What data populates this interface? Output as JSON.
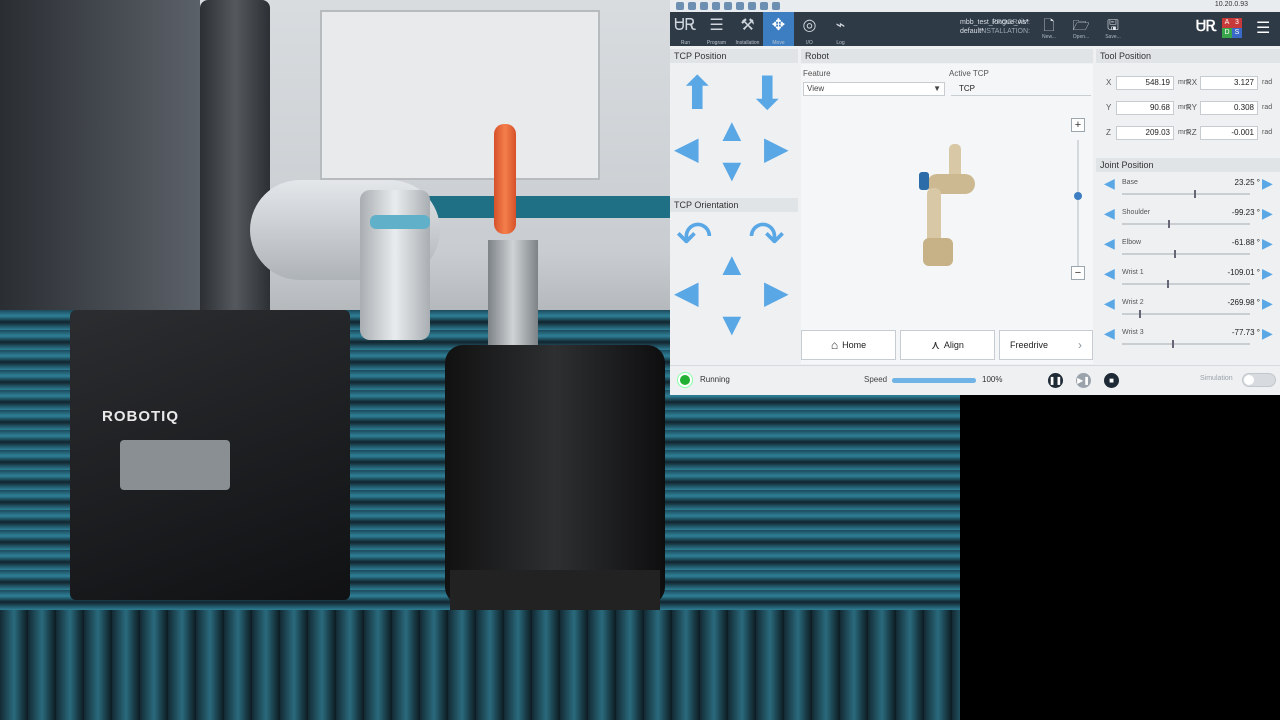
{
  "topbar": {
    "tabs": [
      {
        "name": "run",
        "icon": "ur-icon",
        "label": "Run"
      },
      {
        "name": "program",
        "icon": "program-icon",
        "label": "Program"
      },
      {
        "name": "installation",
        "icon": "installation-icon",
        "label": "Installation"
      },
      {
        "name": "move",
        "icon": "move-icon",
        "label": "Move",
        "active": true
      },
      {
        "name": "io",
        "icon": "io-icon",
        "label": "I/O"
      },
      {
        "name": "log",
        "icon": "log-icon",
        "label": "Log"
      }
    ],
    "program_label": "PROGRAM:",
    "program_value": "mbb_test_longue_vis*",
    "installation_label": "INSTALLATION:",
    "installation_value": "default*",
    "file_buttons": [
      {
        "name": "new",
        "label": "New..."
      },
      {
        "name": "open",
        "label": "Open..."
      },
      {
        "name": "save",
        "label": "Save..."
      }
    ],
    "ip_address": "10.20.0.93",
    "mode_letters": [
      "A",
      "3",
      "D",
      "S"
    ]
  },
  "tcp_position": {
    "title": "TCP Position"
  },
  "tcp_orientation": {
    "title": "TCP Orientation"
  },
  "robot": {
    "title": "Robot",
    "feature_label": "Feature",
    "feature_value": "View",
    "active_tcp_label": "Active TCP",
    "active_tcp_value": "TCP"
  },
  "buttons": {
    "home": "Home",
    "align": "Align",
    "freedrive": "Freedrive"
  },
  "tool_position": {
    "title": "Tool Position",
    "rows": [
      {
        "axis": "X",
        "value": "548.19",
        "unit": "mm",
        "raxis": "RX",
        "rvalue": "3.127",
        "runit": "rad"
      },
      {
        "axis": "Y",
        "value": "90.68",
        "unit": "mm",
        "raxis": "RY",
        "rvalue": "0.308",
        "runit": "rad"
      },
      {
        "axis": "Z",
        "value": "209.03",
        "unit": "mm",
        "raxis": "RZ",
        "rvalue": "-0.001",
        "runit": "rad"
      }
    ]
  },
  "joint_position": {
    "title": "Joint Position",
    "joints": [
      {
        "name": "Base",
        "value": "23.25 °",
        "slider_fraction": 0.56
      },
      {
        "name": "Shoulder",
        "value": "-99.23 °",
        "slider_fraction": 0.36
      },
      {
        "name": "Elbow",
        "value": "-61.88 °",
        "slider_fraction": 0.41
      },
      {
        "name": "Wrist 1",
        "value": "-109.01 °",
        "slider_fraction": 0.35
      },
      {
        "name": "Wrist 2",
        "value": "-269.98 °",
        "slider_fraction": 0.13
      },
      {
        "name": "Wrist 3",
        "value": "-77.73 °",
        "slider_fraction": 0.39
      }
    ]
  },
  "status": {
    "state": "Running",
    "speed_label": "Speed",
    "speed_value": "100%",
    "speed_fraction": 1.0,
    "simulation_label": "Simulation"
  },
  "scene": {
    "brand_text": "ROBOTIQ"
  },
  "colors": {
    "accent": "#3d7dc2",
    "arrow": "#5aa7e6",
    "running": "#21b033",
    "topbar": "#2f3a47"
  }
}
